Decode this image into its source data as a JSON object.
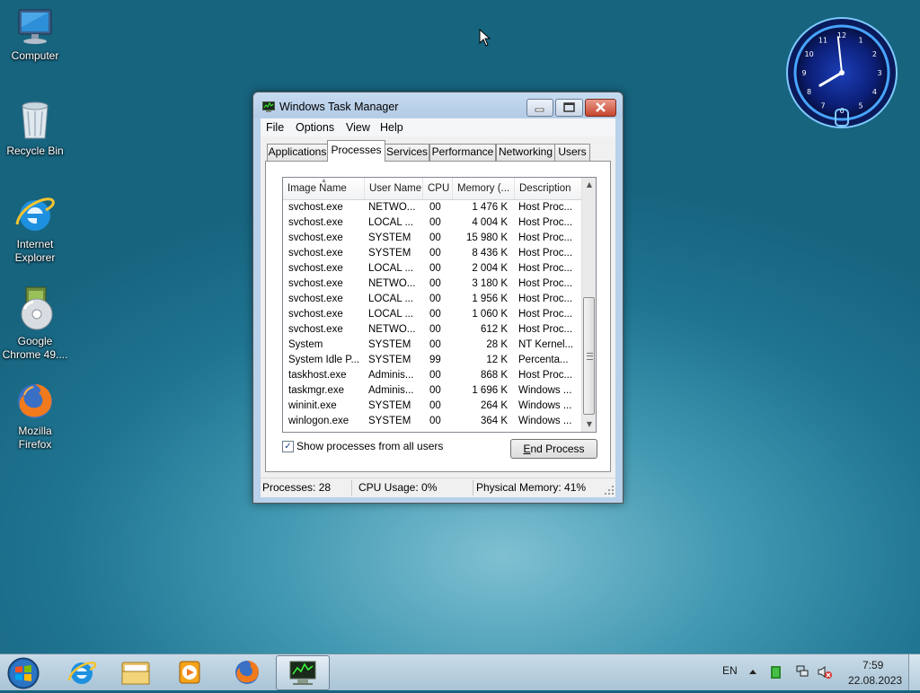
{
  "desktop": {
    "icons": [
      {
        "label": "Computer"
      },
      {
        "label": "Recycle Bin"
      },
      {
        "label": "Internet Explorer"
      },
      {
        "label": "Google Chrome 49...."
      },
      {
        "label": "Mozilla Firefox"
      }
    ],
    "clock": {
      "hour": 7,
      "minute": 59,
      "numbers": [
        "12",
        "1",
        "2",
        "3",
        "4",
        "5",
        "6",
        "7",
        "8",
        "9",
        "10",
        "11"
      ]
    }
  },
  "window": {
    "title": "Windows Task Manager",
    "menu": [
      "File",
      "Options",
      "View",
      "Help"
    ],
    "tabs": [
      "Applications",
      "Processes",
      "Services",
      "Performance",
      "Networking",
      "Users"
    ],
    "active_tab": "Processes",
    "columns": [
      "Image Name",
      "User Name",
      "CPU",
      "Memory (...",
      "Description"
    ],
    "rows": [
      {
        "name": "svchost.exe",
        "user": "NETWO...",
        "cpu": "00",
        "mem": "1 476 K",
        "desc": "Host Proc..."
      },
      {
        "name": "svchost.exe",
        "user": "LOCAL ...",
        "cpu": "00",
        "mem": "4 004 K",
        "desc": "Host Proc..."
      },
      {
        "name": "svchost.exe",
        "user": "SYSTEM",
        "cpu": "00",
        "mem": "15 980 K",
        "desc": "Host Proc..."
      },
      {
        "name": "svchost.exe",
        "user": "SYSTEM",
        "cpu": "00",
        "mem": "8 436 K",
        "desc": "Host Proc..."
      },
      {
        "name": "svchost.exe",
        "user": "LOCAL ...",
        "cpu": "00",
        "mem": "2 004 K",
        "desc": "Host Proc..."
      },
      {
        "name": "svchost.exe",
        "user": "NETWO...",
        "cpu": "00",
        "mem": "3 180 K",
        "desc": "Host Proc..."
      },
      {
        "name": "svchost.exe",
        "user": "LOCAL ...",
        "cpu": "00",
        "mem": "1 956 K",
        "desc": "Host Proc..."
      },
      {
        "name": "svchost.exe",
        "user": "LOCAL ...",
        "cpu": "00",
        "mem": "1 060 K",
        "desc": "Host Proc..."
      },
      {
        "name": "svchost.exe",
        "user": "NETWO...",
        "cpu": "00",
        "mem": "612 K",
        "desc": "Host Proc..."
      },
      {
        "name": "System",
        "user": "SYSTEM",
        "cpu": "00",
        "mem": "28 K",
        "desc": "NT Kernel..."
      },
      {
        "name": "System Idle P...",
        "user": "SYSTEM",
        "cpu": "99",
        "mem": "12 K",
        "desc": "Percenta..."
      },
      {
        "name": "taskhost.exe",
        "user": "Adminis...",
        "cpu": "00",
        "mem": "868 K",
        "desc": "Host Proc..."
      },
      {
        "name": "taskmgr.exe",
        "user": "Adminis...",
        "cpu": "00",
        "mem": "1 696 K",
        "desc": "Windows ..."
      },
      {
        "name": "wininit.exe",
        "user": "SYSTEM",
        "cpu": "00",
        "mem": "264 K",
        "desc": "Windows ..."
      },
      {
        "name": "winlogon.exe",
        "user": "SYSTEM",
        "cpu": "00",
        "mem": "364 K",
        "desc": "Windows ..."
      }
    ],
    "show_all_label": "Show processes from all users",
    "show_all_checked": true,
    "end_process_prefix": "",
    "end_process_mnemonic": "E",
    "end_process_rest": "nd Process",
    "status": {
      "processes": "Processes: 28",
      "cpu": "CPU Usage: 0%",
      "memory": "Physical Memory: 41%"
    }
  },
  "taskbar": {
    "language": "EN",
    "time": "7:59",
    "date": "22.08.2023"
  },
  "colors": {
    "desktop_accent": "#1f7592",
    "window_frame": "#b9d1ea",
    "close_button": "#c7452d"
  }
}
